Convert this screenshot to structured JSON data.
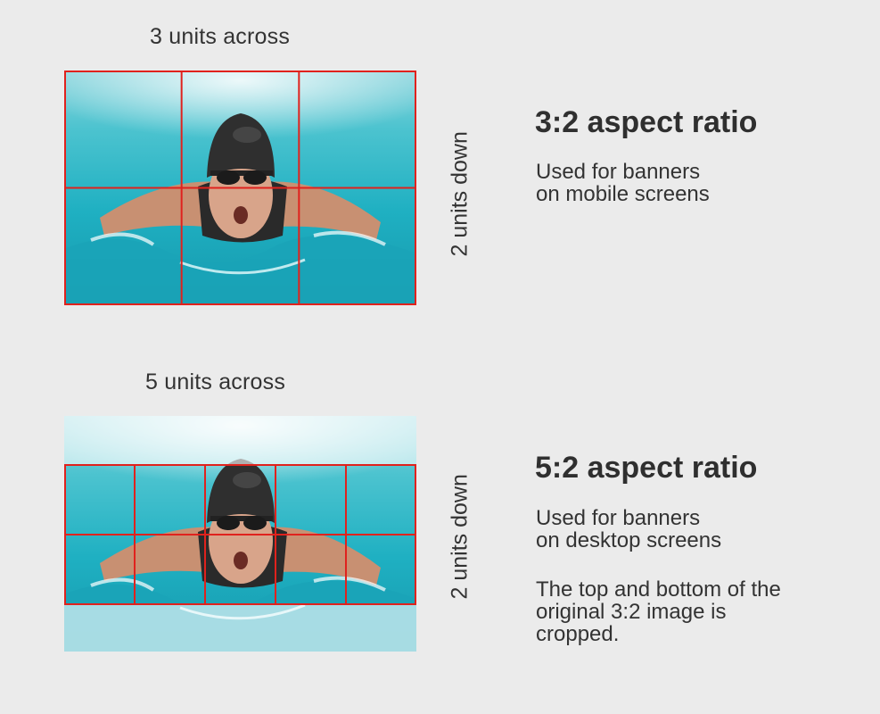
{
  "example_32": {
    "across_label": "3 units across",
    "down_label": "2 units down",
    "heading": "3:2 aspect ratio",
    "description": "Used for banners\non mobile screens",
    "columns": 3,
    "rows": 2
  },
  "example_52": {
    "across_label": "5 units across",
    "down_label": "2 units down",
    "heading": "5:2 aspect ratio",
    "description": "Used for banners\non desktop screens",
    "note": "The top and bottom of the\noriginal 3:2 image is\ncropped.",
    "columns": 5,
    "rows": 2
  },
  "colors": {
    "grid_line": "#e0221d",
    "water": "#2cb8c8",
    "background": "#ebebeb"
  },
  "image_subject": "swimmer-butterfly-stroke-photo"
}
